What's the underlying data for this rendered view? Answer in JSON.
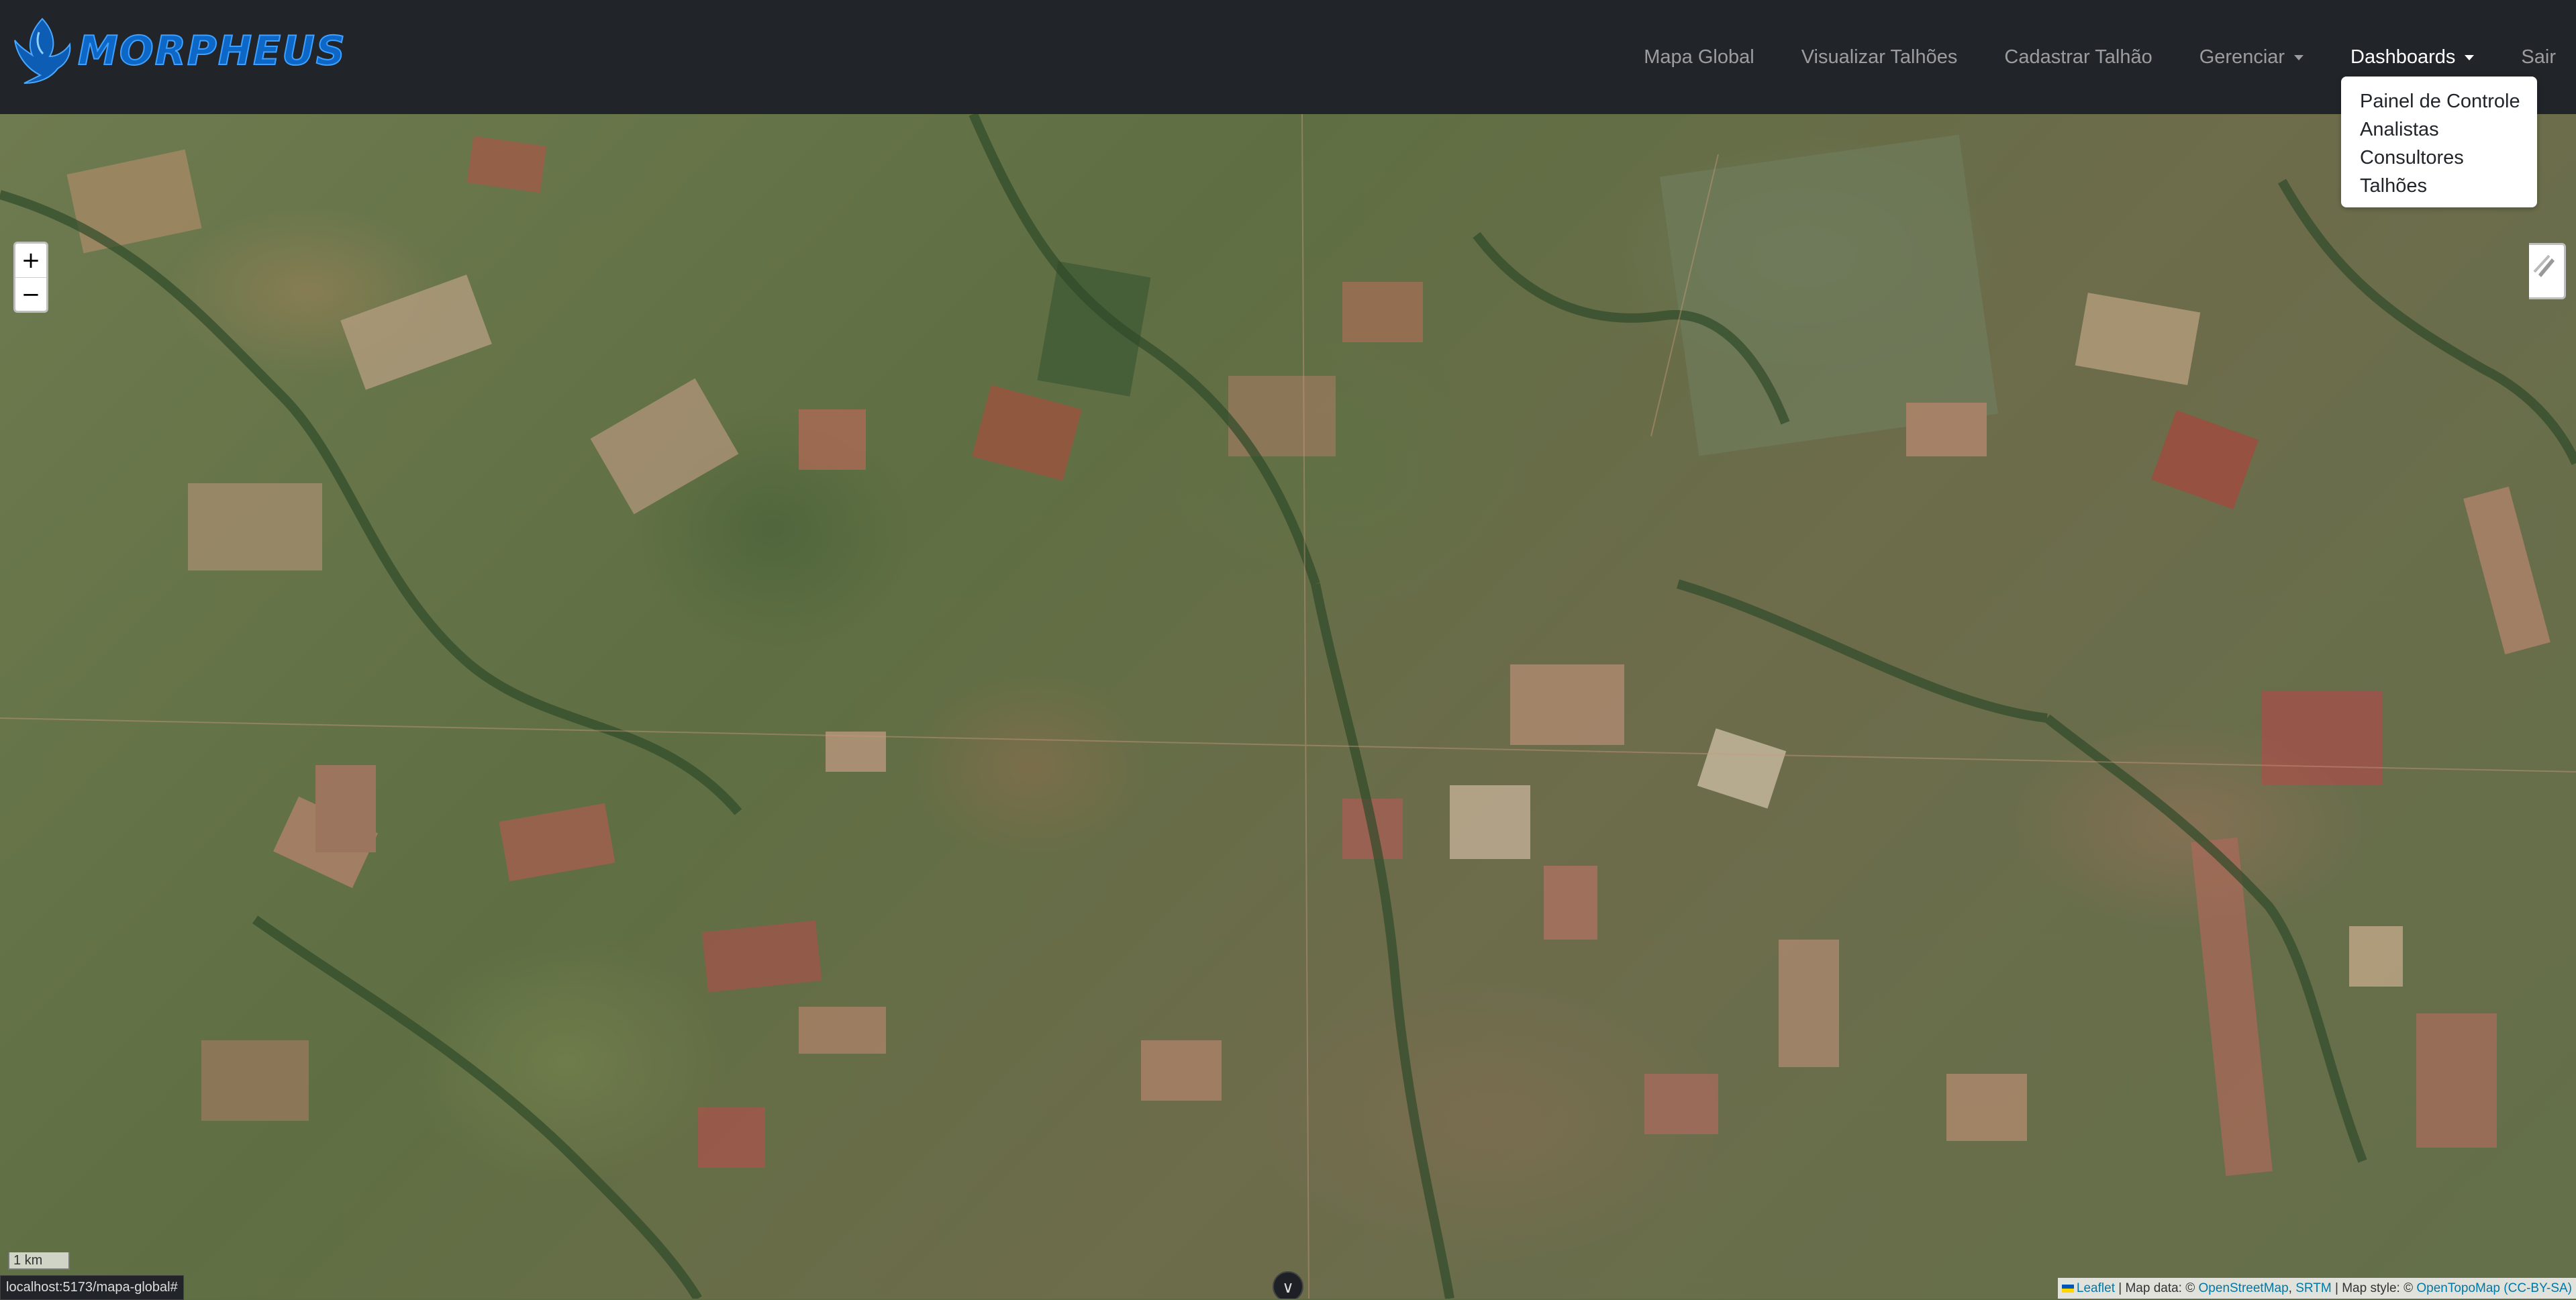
{
  "brand": {
    "name": "MORPHEUS"
  },
  "nav": {
    "items": [
      {
        "label": "Mapa Global"
      },
      {
        "label": "Visualizar Talhões"
      },
      {
        "label": "Cadastrar Talhão"
      },
      {
        "label": "Gerenciar"
      },
      {
        "label": "Dashboards"
      },
      {
        "label": "Sair"
      }
    ]
  },
  "dropdown": {
    "items": [
      {
        "label": "Painel de Controle"
      },
      {
        "label": "Analistas"
      },
      {
        "label": "Consultores"
      },
      {
        "label": "Talhões"
      }
    ]
  },
  "map": {
    "zoom_in": "+",
    "zoom_out": "−",
    "scale": "1 km",
    "attribution": {
      "leaflet": "Leaflet",
      "map_data": "| Map data: ©",
      "osm": "OpenStreetMap",
      "sep": ",",
      "srtm": "SRTM",
      "style": "| Map style: ©",
      "topo": "OpenTopoMap",
      "license": "(CC-BY-SA)"
    }
  },
  "status": {
    "url": "localhost:5173/mapa-global#"
  },
  "colors": {
    "navbar": "#212529",
    "brand": "#0c67c7",
    "link": "#0078a8"
  }
}
